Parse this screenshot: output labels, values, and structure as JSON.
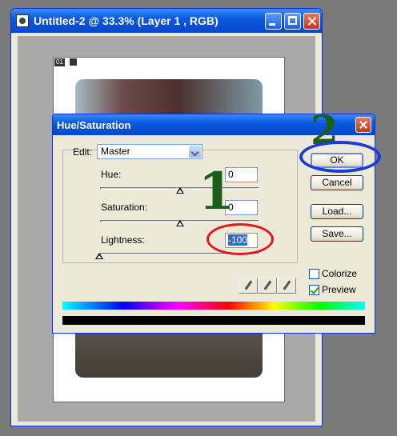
{
  "document_window": {
    "title": "Untitled-2 @ 33.3% (Layer 1 , RGB)",
    "page_tag": "01"
  },
  "dialog": {
    "title": "Hue/Saturation",
    "edit_label": "Edit:",
    "edit_value": "Master",
    "hue_label": "Hue:",
    "hue_value": "0",
    "saturation_label": "Saturation:",
    "saturation_value": "0",
    "lightness_label": "Lightness:",
    "lightness_value": "-100",
    "buttons": {
      "ok": "OK",
      "cancel": "Cancel",
      "load": "Load...",
      "save": "Save..."
    },
    "colorize_label": "Colorize",
    "colorize_checked": false,
    "preview_label": "Preview",
    "preview_checked": true
  },
  "annotations": {
    "step1": "1",
    "step2": "2"
  },
  "colors": {
    "title_bar": "#0a5ae0",
    "annotation_red": "#e8141a",
    "annotation_blue": "#1f3ad6",
    "annotation_green": "#1a5e1a"
  }
}
